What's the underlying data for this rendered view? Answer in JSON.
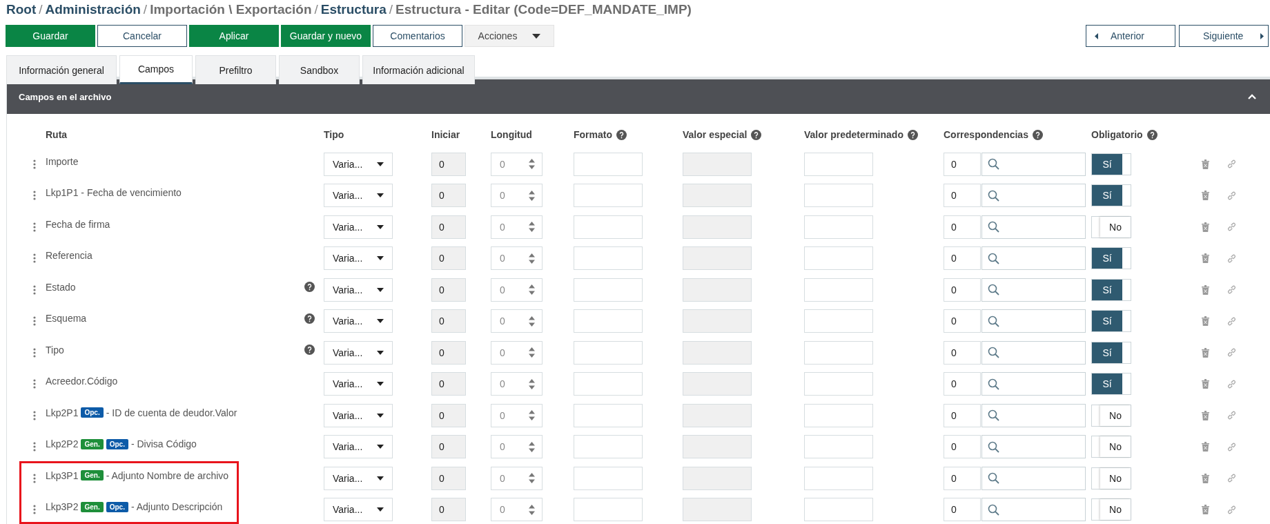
{
  "breadcrumb": [
    {
      "text": "Root",
      "kind": "link"
    },
    {
      "text": "/",
      "kind": "separator"
    },
    {
      "text": "Administración",
      "kind": "link"
    },
    {
      "text": "/",
      "kind": "separator"
    },
    {
      "text": "Importación \\ Exportación",
      "kind": "plain"
    },
    {
      "text": "/",
      "kind": "separator"
    },
    {
      "text": "Estructura",
      "kind": "link"
    },
    {
      "text": "/",
      "kind": "separator"
    },
    {
      "text": "Estructura - Editar (Code=DEF_MANDATE_IMP)",
      "kind": "plain"
    }
  ],
  "toolbar": {
    "buttons": [
      {
        "label": "Guardar",
        "kind": "primary"
      },
      {
        "label": "Cancelar",
        "kind": "secondary"
      },
      {
        "label": "Aplicar",
        "kind": "primary"
      },
      {
        "label": "Guardar y nuevo",
        "kind": "primary"
      },
      {
        "label": "Comentarios",
        "kind": "secondary"
      },
      {
        "label": "Acciones",
        "kind": "menu"
      }
    ],
    "nav": [
      {
        "label": "Anterior",
        "kind": "prev"
      },
      {
        "label": "Siguiente",
        "kind": "next"
      }
    ]
  },
  "tabs": [
    {
      "label": "Información general",
      "selected": false
    },
    {
      "label": "Campos",
      "selected": true
    },
    {
      "label": "Prefiltro",
      "selected": false
    },
    {
      "label": "Sandbox",
      "selected": false
    },
    {
      "label": "Información adicional",
      "selected": false
    }
  ],
  "panel": {
    "title": "Campos en el archivo",
    "expanded": true,
    "columns": [
      {
        "label": "Ruta",
        "help": false
      },
      {
        "label": "Tipo",
        "help": false
      },
      {
        "label": "Iniciar",
        "help": false
      },
      {
        "label": "Longitud",
        "help": false
      },
      {
        "label": "Formato",
        "help": true
      },
      {
        "label": "Valor especial",
        "help": true
      },
      {
        "label": "Valor predeterminado",
        "help": true
      },
      {
        "label": "Correspondencias",
        "help": true
      },
      {
        "label": "Obligatorio",
        "help": true
      }
    ],
    "rows": [
      {
        "path": "Importe",
        "help": false,
        "type": "Varia...",
        "start": "0",
        "length": "0",
        "mapping": "0",
        "required": true,
        "required_label": "Sí",
        "highlighted": false
      },
      {
        "path": "Lkp1P1 - Fecha de vencimiento",
        "help": false,
        "type": "Varia...",
        "start": "0",
        "length": "0",
        "mapping": "0",
        "required": true,
        "required_label": "Sí",
        "highlighted": false
      },
      {
        "path": "Fecha de firma",
        "help": false,
        "type": "Varia...",
        "start": "0",
        "length": "0",
        "mapping": "0",
        "required": false,
        "required_label": "No",
        "highlighted": false
      },
      {
        "path": "Referencia",
        "help": false,
        "type": "Varia...",
        "start": "0",
        "length": "0",
        "mapping": "0",
        "required": true,
        "required_label": "Sí",
        "highlighted": false
      },
      {
        "path": "Estado",
        "help": true,
        "type": "Varia...",
        "start": "0",
        "length": "0",
        "mapping": "0",
        "required": true,
        "required_label": "Sí",
        "highlighted": false
      },
      {
        "path": "Esquema",
        "help": true,
        "type": "Varia...",
        "start": "0",
        "length": "0",
        "mapping": "0",
        "required": true,
        "required_label": "Sí",
        "highlighted": false
      },
      {
        "path": "Tipo",
        "help": true,
        "type": "Varia...",
        "start": "0",
        "length": "0",
        "mapping": "0",
        "required": true,
        "required_label": "Sí",
        "highlighted": false
      },
      {
        "path": "Acreedor.Código",
        "help": false,
        "type": "Varia...",
        "start": "0",
        "length": "0",
        "mapping": "0",
        "required": true,
        "required_label": "Sí",
        "highlighted": false
      },
      {
        "path": "Lkp2P1",
        "badges": [
          {
            "text": "Opc.",
            "kind": "opc"
          }
        ],
        "suffix": "- ID de cuenta de deudor.Valor",
        "help": false,
        "type": "Varia...",
        "start": "0",
        "length": "0",
        "mapping": "0",
        "required": false,
        "required_label": "No",
        "highlighted": false
      },
      {
        "path": "Lkp2P2",
        "badges": [
          {
            "text": "Gen.",
            "kind": "gen"
          },
          {
            "text": "Opc.",
            "kind": "opc"
          }
        ],
        "suffix": "- Divisa Código",
        "help": false,
        "type": "Varia...",
        "start": "0",
        "length": "0",
        "mapping": "0",
        "required": false,
        "required_label": "No",
        "highlighted": false
      },
      {
        "path": "Lkp3P1",
        "badges": [
          {
            "text": "Gen.",
            "kind": "gen"
          }
        ],
        "suffix": "- Adjunto Nombre de archivo",
        "help": false,
        "type": "Varia...",
        "start": "0",
        "length": "0",
        "mapping": "0",
        "required": false,
        "required_label": "No",
        "highlighted": true
      },
      {
        "path": "Lkp3P2",
        "badges": [
          {
            "text": "Gen.",
            "kind": "gen"
          },
          {
            "text": "Opc.",
            "kind": "opc"
          }
        ],
        "suffix": "- Adjunto Descripción",
        "help": false,
        "type": "Varia...",
        "start": "0",
        "length": "0",
        "mapping": "0",
        "required": false,
        "required_label": "No",
        "highlighted": true
      }
    ]
  }
}
